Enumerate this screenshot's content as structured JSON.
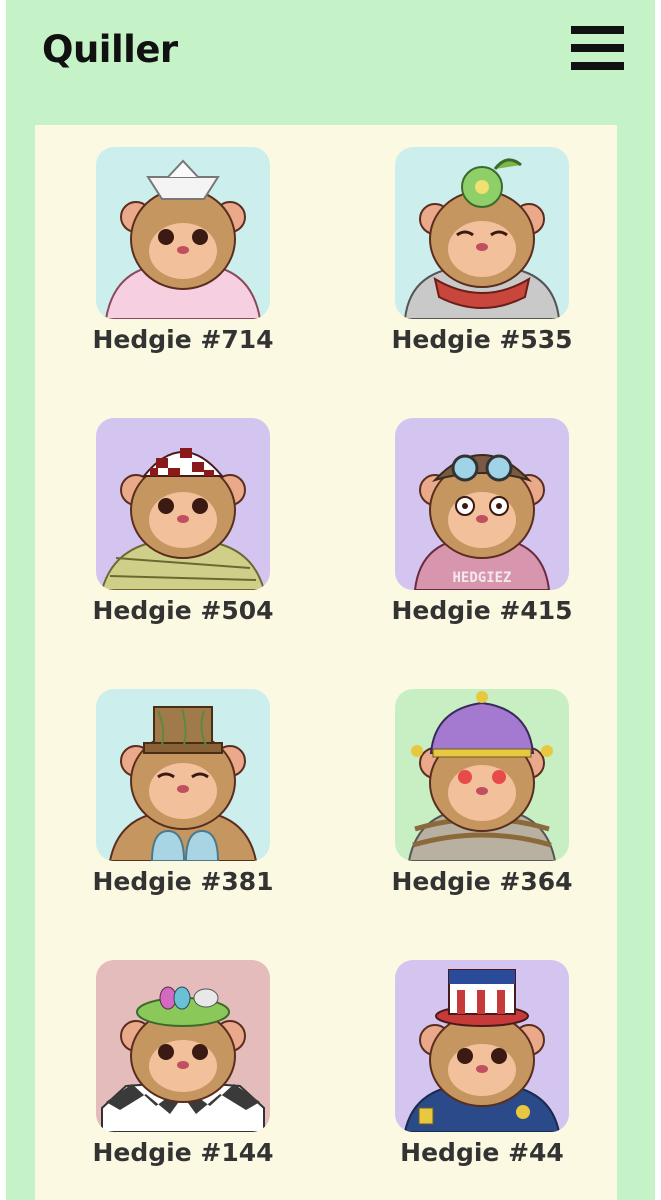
{
  "header": {
    "app_title": "Quiller",
    "menu_icon": "hamburger-menu-icon"
  },
  "hedgies": [
    {
      "label": "Hedgie #714",
      "background": "#ccefee",
      "accessory": "paper-boat-hat",
      "outfit": "pink-robe"
    },
    {
      "label": "Hedgie #535",
      "background": "#ccefee",
      "accessory": "flower-plant-crown",
      "outfit": "armor-and-red-scarf"
    },
    {
      "label": "Hedgie #504",
      "background": "#d4c4f0",
      "accessory": "checkered-cap",
      "outfit": "green-wraps"
    },
    {
      "label": "Hedgie #415",
      "background": "#d4c4f0",
      "accessory": "aviator-goggles-helmet",
      "outfit": "pink-hoodie",
      "hoodie_text": "HEDGIEZ"
    },
    {
      "label": "Hedgie #381",
      "background": "#ccefee",
      "accessory": "pot-hat",
      "outfit": "seashells"
    },
    {
      "label": "Hedgie #364",
      "background": "#c8efc4",
      "accessory": "jester-hat",
      "outfit": "rope-chest"
    },
    {
      "label": "Hedgie #144",
      "background": "#e4bcbc",
      "accessory": "egg-nest-with-bunny",
      "outfit": "jester-collar"
    },
    {
      "label": "Hedgie #44",
      "background": "#d4c4f0",
      "accessory": "uncle-sam-hat",
      "outfit": "police-uniform"
    }
  ]
}
